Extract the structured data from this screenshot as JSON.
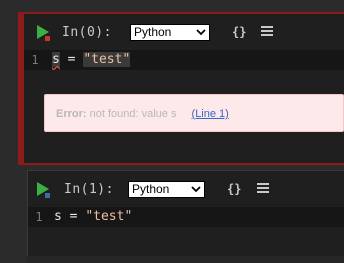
{
  "cells": [
    {
      "label": "In(0):",
      "language": "Python",
      "braces_label": "{}",
      "line_number": "1",
      "code": {
        "var": "s",
        "op": " = ",
        "str": "\"test\""
      },
      "error": {
        "label": "Error:",
        "message": "not found: value s",
        "link": "(Line 1)"
      },
      "border_color": "#8e1b1b"
    },
    {
      "label": "In(1):",
      "language": "Python",
      "braces_label": "{}",
      "line_number": "1",
      "code": {
        "var": "s",
        "op": " = ",
        "str": "\"test\""
      }
    }
  ],
  "icons": {
    "run": "play-icon",
    "menu": "hamburger-menu-icon",
    "dropdown": "chevron-down-icon"
  },
  "colors": {
    "run_green": "#3cb043",
    "error_border": "#8e1b1b",
    "error_bg": "#fde9ea",
    "link": "#3a65c9",
    "string": "#f0bfa0"
  }
}
